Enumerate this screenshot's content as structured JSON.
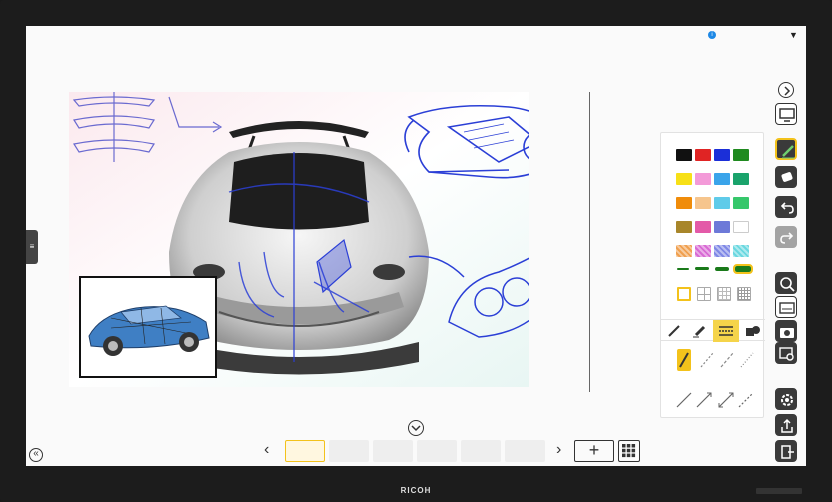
{
  "device": {
    "brand": "RICOH"
  },
  "topbar": {
    "info_icon": "info-icon",
    "menu_icon": "caret-down-icon"
  },
  "colors": {
    "accent": "#f3c21b",
    "ink_blue": "#2b3fd6",
    "info_blue": "#1e88e5"
  },
  "palette": {
    "swatches": [
      [
        "#111111",
        "#e02424",
        "#1b2fd8",
        "#1f8a1f"
      ],
      [
        "#f7e017",
        "#f39ad8",
        "#3aa4ea",
        "#1aa36b"
      ],
      [
        "#f08c0a",
        "#f6c58d",
        "#5fcbe9",
        "#36c76b"
      ],
      [
        "#a8862a",
        "#e35aa8",
        "#6d79d8",
        "#ffffff"
      ],
      [
        "#f0a050",
        "#d86ad4",
        "#7f88e6",
        "#6ad8e0"
      ]
    ],
    "thickness_color": "#1a7a1a",
    "tool_tabs": [
      "pen-tool-icon",
      "marker-tool-icon",
      "line-style-icon",
      "shape-tool-icon"
    ],
    "active_tool_tab": 2
  },
  "toolbar_right": {
    "items": [
      "collapse-icon",
      "display-icon",
      "pen-icon",
      "eraser-icon",
      "undo-icon",
      "redo-icon",
      "zoom-icon",
      "screenshot-icon",
      "camera-icon",
      "capture-icon",
      "settings-icon",
      "share-icon",
      "exit-icon"
    ]
  },
  "pages": {
    "count": 6,
    "active": 0,
    "add_label": "+"
  }
}
